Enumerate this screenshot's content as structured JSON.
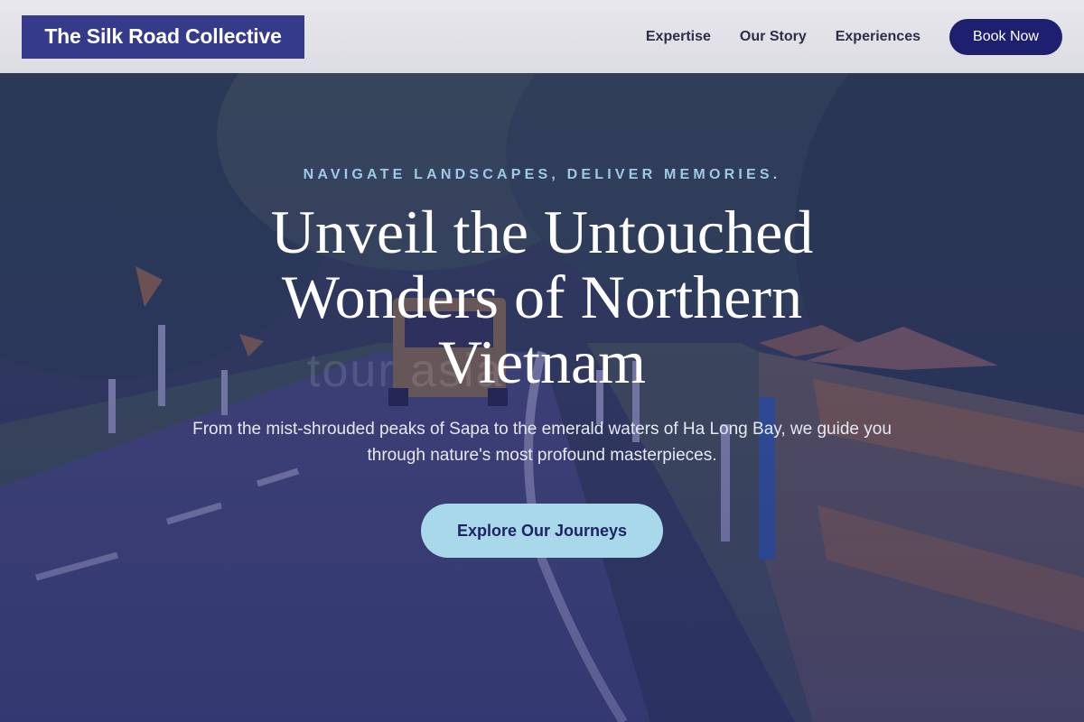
{
  "header": {
    "brand": "The Silk Road Collective",
    "nav": [
      {
        "label": "Expertise"
      },
      {
        "label": "Our Story"
      },
      {
        "label": "Experiences"
      }
    ],
    "cta_label": "Book Now"
  },
  "hero": {
    "eyebrow": "NAVIGATE LANDSCAPES, DELIVER MEMORIES.",
    "headline": "Unveil the Untouched Wonders of Northern Vietnam",
    "subtitle": "From the mist-shrouded peaks of Sapa to the emerald waters of Ha Long Bay, we guide you through nature's most profound masterpieces.",
    "cta_label": "Explore Our Journeys",
    "watermark": "tour                    asia"
  },
  "colors": {
    "brand_bg": "#363a8a",
    "book_button": "#1e1f6e",
    "cta_button": "#a9d8ea",
    "eyebrow": "#9fc9e6"
  }
}
